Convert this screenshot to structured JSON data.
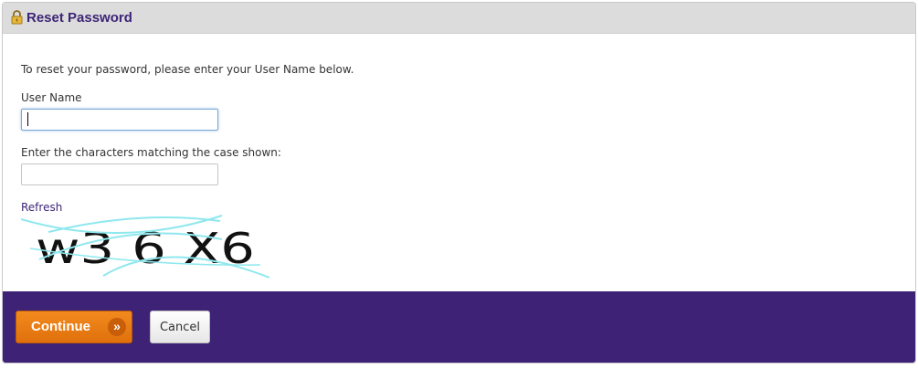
{
  "header": {
    "title": "Reset Password",
    "icon": "lock-icon"
  },
  "form": {
    "intro": "To reset your password, please enter your User Name below.",
    "username_label": "User Name",
    "username_value": "",
    "captcha_label": "Enter the characters matching the case shown:",
    "captcha_value": "",
    "refresh_label": "Refresh",
    "captcha_image_text": "w3 6 X6"
  },
  "footer": {
    "continue_label": "Continue",
    "continue_icon": "double-chevron-right-icon",
    "cancel_label": "Cancel"
  },
  "colors": {
    "header_bg": "#dcdcdc",
    "title": "#3d2576",
    "footer_bg": "#3d2276",
    "continue_button": "#e87b14",
    "captcha_noise": "#8fe8ee"
  }
}
